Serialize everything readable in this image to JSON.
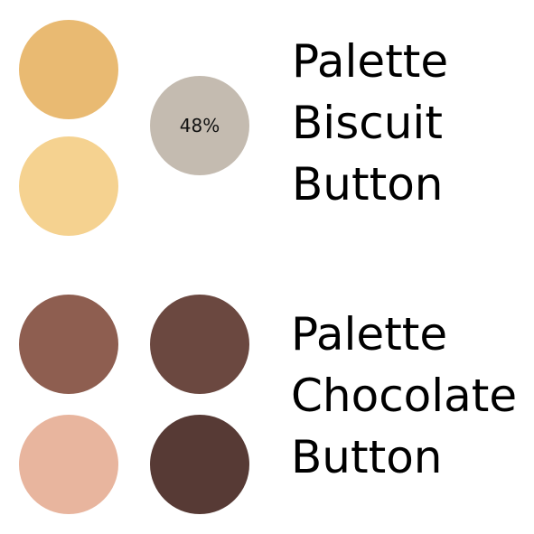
{
  "palettes": {
    "biscuit": {
      "title_lines": [
        "Palette",
        "Biscuit",
        "Button"
      ],
      "swatches": [
        {
          "color": "#E9BA72"
        },
        {
          "color": "#F5D290"
        },
        {
          "color": "#C4BBB0",
          "label": "48%"
        }
      ]
    },
    "chocolate": {
      "title_lines": [
        "Palette",
        "Chocolate",
        "Button"
      ],
      "swatches": [
        {
          "color": "#8E5E50"
        },
        {
          "color": "#6B4840"
        },
        {
          "color": "#E8B59E"
        },
        {
          "color": "#573A35"
        }
      ]
    }
  }
}
